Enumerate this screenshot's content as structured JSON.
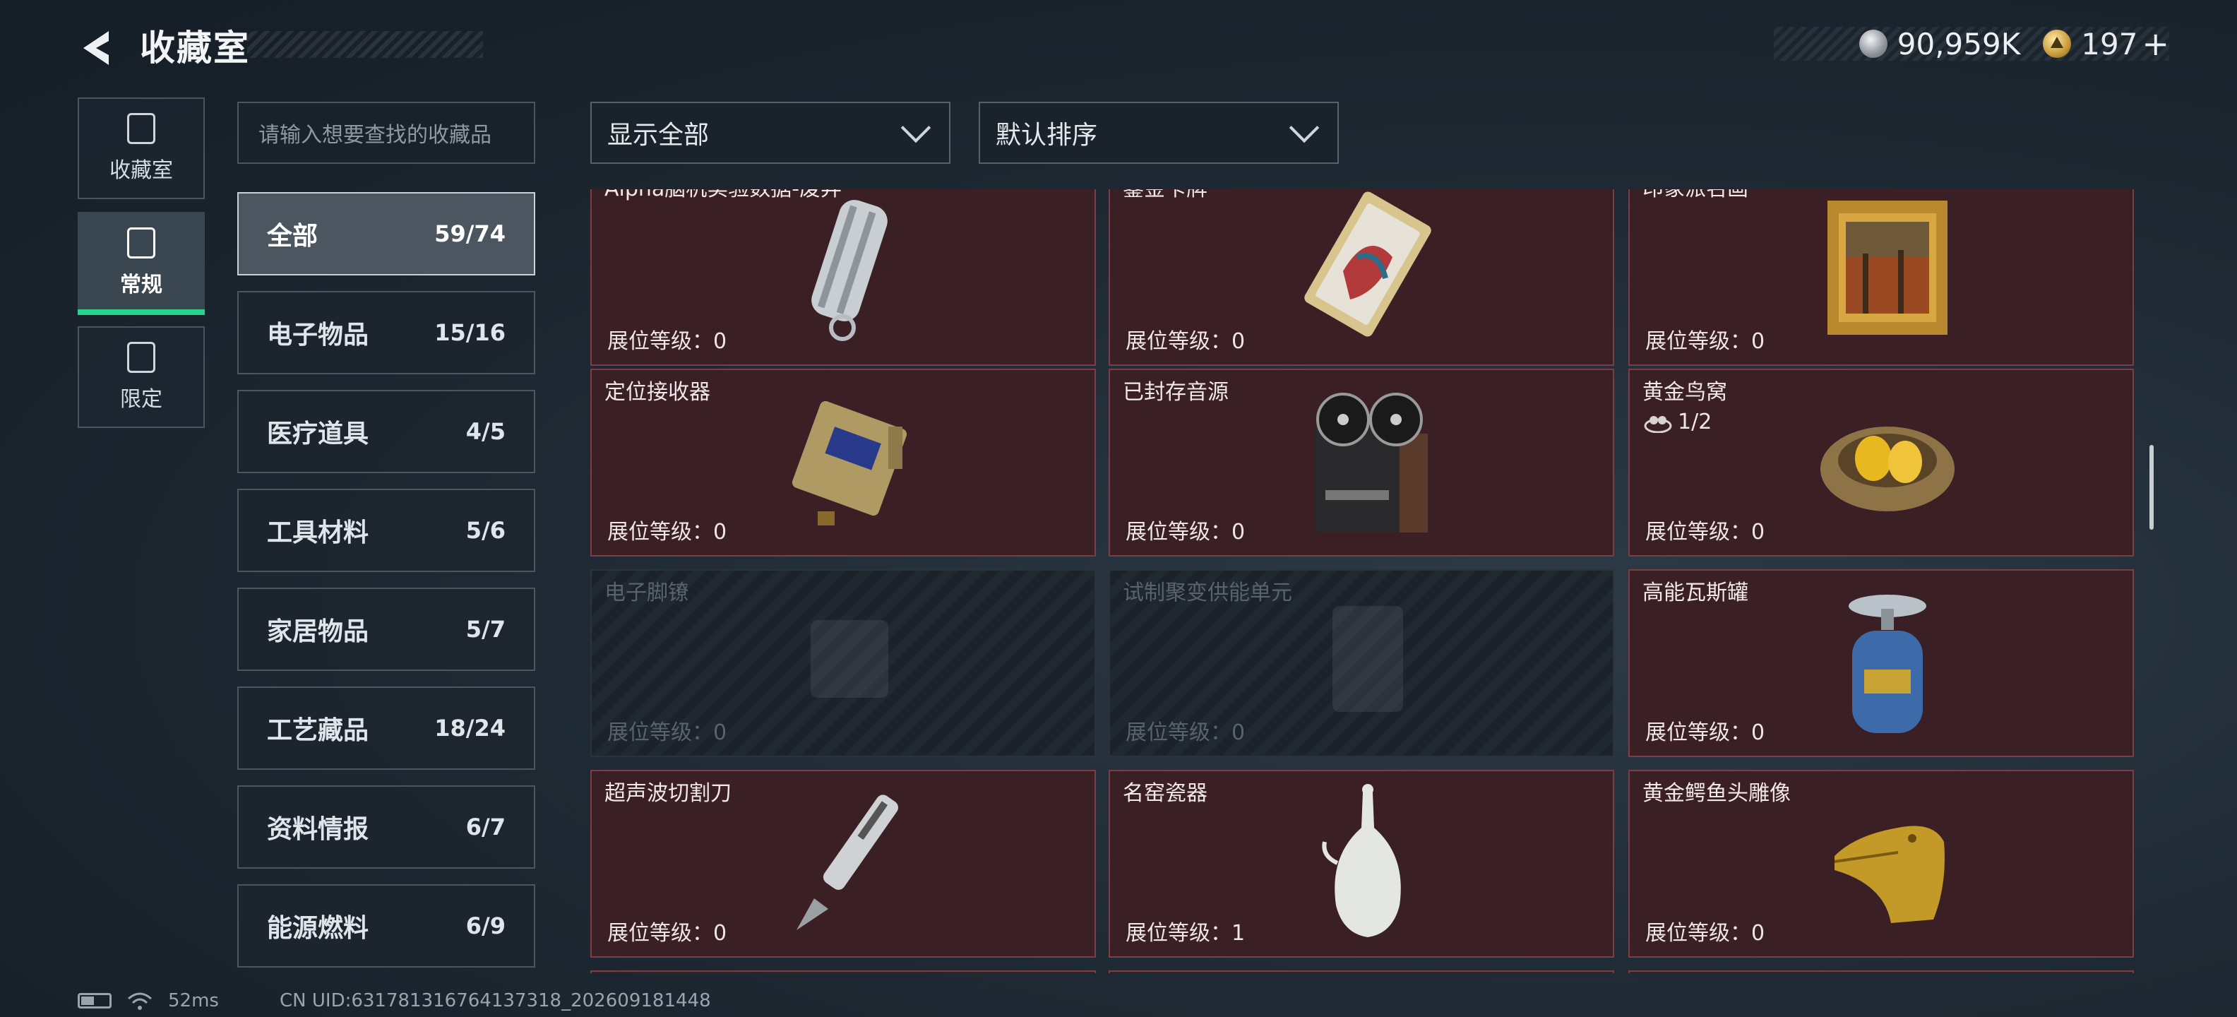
{
  "header": {
    "title": "收藏室"
  },
  "currency": {
    "silver": "90,959K",
    "gold": "197",
    "plus": "+"
  },
  "rail": [
    {
      "label": "收藏室",
      "icon": "collection-icon"
    },
    {
      "label": "常规",
      "icon": "regular-icon"
    },
    {
      "label": "限定",
      "icon": "limited-icon"
    }
  ],
  "search": {
    "placeholder": "请输入想要查找的收藏品"
  },
  "filters": {
    "show": "显示全部",
    "sort": "默认排序"
  },
  "categories": [
    {
      "name": "全部",
      "count": "59/74"
    },
    {
      "name": "电子物品",
      "count": "15/16"
    },
    {
      "name": "医疗道具",
      "count": "4/5"
    },
    {
      "name": "工具材料",
      "count": "5/6"
    },
    {
      "name": "家居物品",
      "count": "5/7"
    },
    {
      "name": "工艺藏品",
      "count": "18/24"
    },
    {
      "name": "资料情报",
      "count": "6/7"
    },
    {
      "name": "能源燃料",
      "count": "6/9"
    }
  ],
  "items": [
    {
      "name": "Alpha脑机实验数据-废弃",
      "level": "展位等级：0",
      "icon": "usb-drive-icon"
    },
    {
      "name": "鎏金卡牌",
      "level": "展位等级：0",
      "icon": "gold-card-icon"
    },
    {
      "name": "印象派名画",
      "level": "展位等级：0",
      "icon": "painting-icon"
    },
    {
      "name": "定位接收器",
      "level": "展位等级：0",
      "icon": "receiver-icon"
    },
    {
      "name": "已封存音源",
      "level": "展位等级：0",
      "icon": "tape-recorder-icon"
    },
    {
      "name": "黄金鸟窝",
      "level": "展位等级：0",
      "progress": "1/2",
      "icon": "golden-nest-icon"
    },
    {
      "name": "电子脚镣",
      "level": "展位等级：0",
      "icon": "ankle-monitor-icon",
      "locked": true
    },
    {
      "name": "试制聚变供能单元",
      "level": "展位等级：0",
      "icon": "fusion-unit-icon",
      "locked": true
    },
    {
      "name": "高能瓦斯罐",
      "level": "展位等级：0",
      "icon": "gas-canister-icon"
    },
    {
      "name": "超声波切割刀",
      "level": "展位等级：0",
      "icon": "ultrasonic-knife-icon"
    },
    {
      "name": "名窑瓷器",
      "level": "展位等级：1",
      "icon": "porcelain-vase-icon"
    },
    {
      "name": "黄金鳄鱼头雕像",
      "level": "展位等级：0",
      "icon": "gold-crocodile-icon"
    }
  ],
  "status": {
    "ping": "52ms",
    "uid": "CN UID:6317813167641373​18_202609181448"
  }
}
